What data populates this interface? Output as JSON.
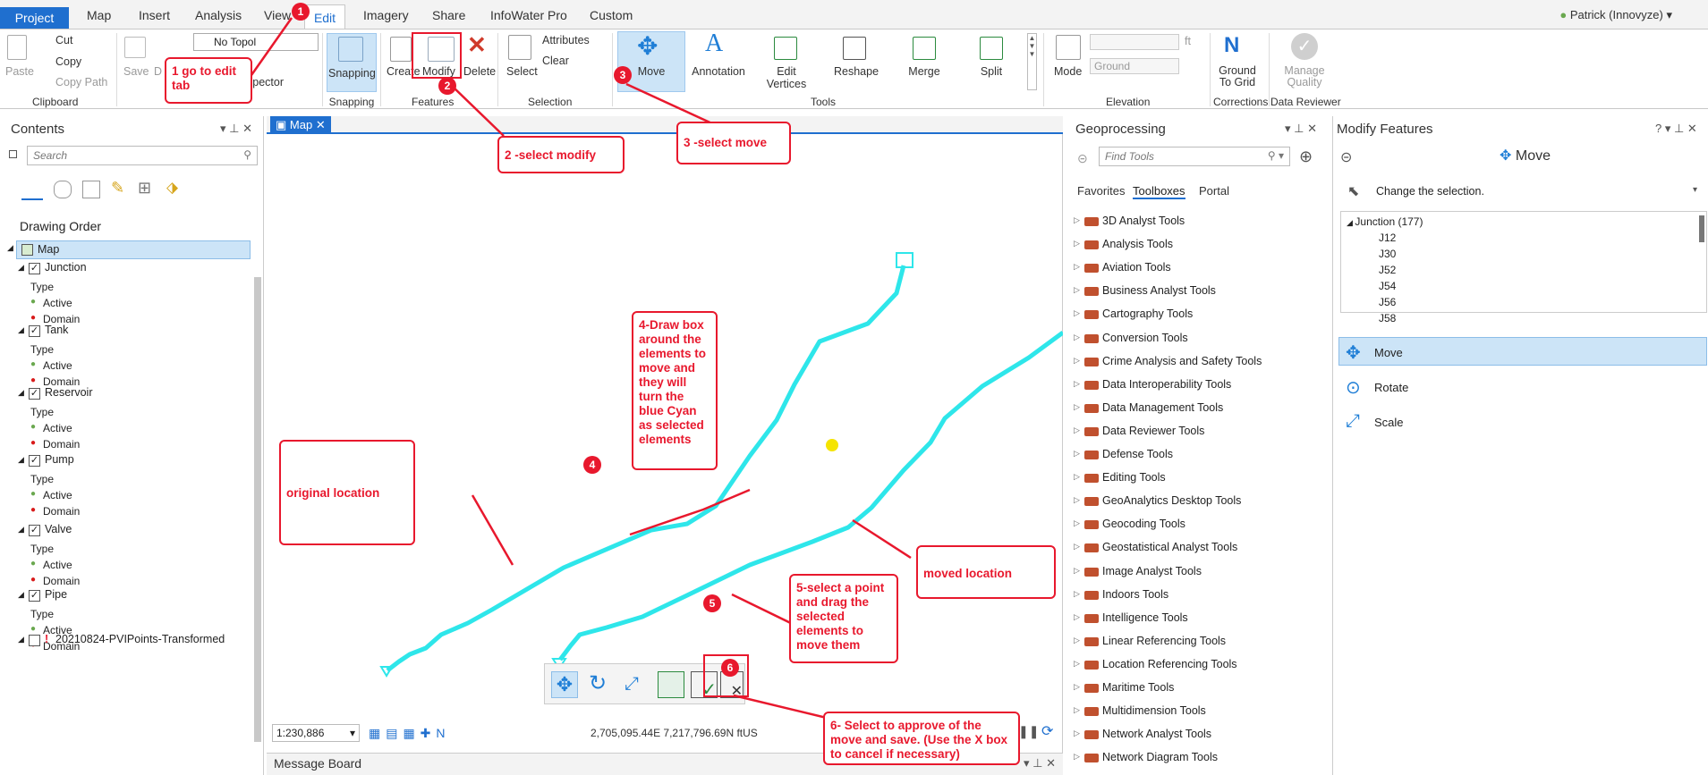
{
  "tabs": {
    "project": "Project",
    "map": "Map",
    "insert": "Insert",
    "analysis": "Analysis",
    "view": "View",
    "edit": "Edit",
    "imagery": "Imagery",
    "share": "Share",
    "infowater": "InfoWater Pro",
    "custom": "Custom"
  },
  "user": "Patrick (Innovyze)",
  "ribbon": {
    "clipboard": {
      "paste": "Paste",
      "cut": "Cut",
      "copy": "Copy",
      "copy_path": "Copy Path",
      "group": "Clipboard"
    },
    "manage": {
      "save": "Save",
      "discard": "D",
      "topology": "No Topol",
      "inspector": "spector"
    },
    "snapping": {
      "label": "Snapping",
      "group": "Snapping"
    },
    "features": {
      "create": "Create",
      "modify": "Modify",
      "delete": "Delete",
      "group": "Features"
    },
    "selection": {
      "select": "Select",
      "attributes": "Attributes",
      "clear": "Clear",
      "group": "Selection"
    },
    "tools": {
      "move": "Move",
      "annotation": "Annotation",
      "edit_vertices_1": "Edit",
      "edit_vertices_2": "Vertices",
      "reshape": "Reshape",
      "merge": "Merge",
      "split": "Split",
      "group": "Tools"
    },
    "elevation": {
      "mode": "Mode",
      "surface": "Ground",
      "unit": "ft",
      "group": "Elevation"
    },
    "corrections": {
      "ground_to_grid_1": "Ground",
      "ground_to_grid_2": "To Grid",
      "group": "Corrections"
    },
    "reviewer": {
      "manage_quality_1": "Manage",
      "manage_quality_2": "Quality",
      "group": "Data Reviewer"
    }
  },
  "contents": {
    "title": "Contents",
    "search_placeholder": "Search",
    "drawing_order": "Drawing Order",
    "map": "Map",
    "layers": [
      {
        "name": "Junction",
        "type": "Type",
        "sym": [
          "Active",
          "Domain"
        ]
      },
      {
        "name": "Tank",
        "type": "Type",
        "sym": [
          "Active",
          "Domain"
        ]
      },
      {
        "name": "Reservoir",
        "type": "Type",
        "sym": [
          "Active",
          "Domain"
        ]
      },
      {
        "name": "Pump",
        "type": "Type",
        "sym": [
          "Active",
          "Domain"
        ]
      },
      {
        "name": "Valve",
        "type": "Type",
        "sym": [
          "Active",
          "Domain"
        ]
      },
      {
        "name": "Pipe",
        "type": "Type",
        "sym": [
          "Active",
          "Domain"
        ]
      }
    ],
    "last_layer": "20210824-PVIPoints-Transformed"
  },
  "map": {
    "tab": "Map",
    "scale": "1:230,886",
    "coords": "2,705,095.44E 7,217,796.69N ftUS"
  },
  "message_board": "Message Board",
  "geoprocessing": {
    "title": "Geoprocessing",
    "find_placeholder": "Find Tools",
    "tabs": [
      "Favorites",
      "Toolboxes",
      "Portal"
    ],
    "toolboxes": [
      "3D Analyst Tools",
      "Analysis Tools",
      "Aviation Tools",
      "Business Analyst Tools",
      "Cartography Tools",
      "Conversion Tools",
      "Crime Analysis and Safety Tools",
      "Data Interoperability Tools",
      "Data Management Tools",
      "Data Reviewer Tools",
      "Defense Tools",
      "Editing Tools",
      "GeoAnalytics Desktop Tools",
      "Geocoding Tools",
      "Geostatistical Analyst Tools",
      "Image Analyst Tools",
      "Indoors Tools",
      "Intelligence Tools",
      "Linear Referencing Tools",
      "Location Referencing Tools",
      "Maritime Tools",
      "Multidimension Tools",
      "Network Analyst Tools",
      "Network Diagram Tools"
    ]
  },
  "modify": {
    "title": "Modify Features",
    "header": "Move",
    "change_selection": "Change the selection.",
    "junction_group": "Junction (177)",
    "junctions": [
      "J12",
      "J30",
      "J52",
      "J54",
      "J56",
      "J58"
    ],
    "tools": [
      "Move",
      "Rotate",
      "Scale"
    ]
  },
  "annotations": {
    "a1": "1 go to edit tab",
    "a2": "2 -select modify",
    "a3": "3  -select move",
    "a4": "4-Draw  box around the elements to move and they will turn the blue Cyan as selected elements",
    "a5": "5-select a point and drag the selected elements to move them",
    "a6": "6- Select to approve of the move and save. (Use the X box to cancel if necessary)",
    "original": "original location",
    "moved": "moved location",
    "n1": "1",
    "n2": "2",
    "n3": "3",
    "n4": "4",
    "n5": "5",
    "n6": "6"
  },
  "colors": {
    "accent": "#1f6fcf",
    "annotation": "#e8182d",
    "selection": "#2ee6ea"
  }
}
